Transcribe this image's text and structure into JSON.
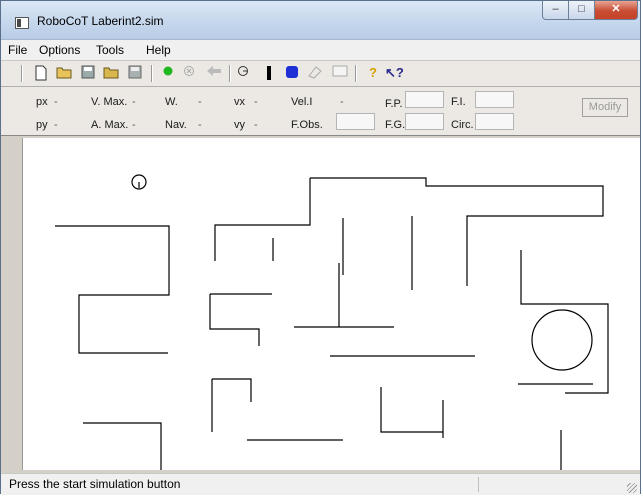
{
  "window": {
    "title": "RoboCoT Laberint2.sim"
  },
  "controls": {
    "minimize": "–",
    "maximize": "□",
    "close": "✕"
  },
  "menu": {
    "items": [
      "File",
      "Options",
      "Tools",
      "Help"
    ]
  },
  "toolbar": {
    "icons": [
      "new-icon",
      "open-icon",
      "save-icon",
      "open-folder-icon",
      "save-as-icon",
      "start-icon",
      "stop-icon",
      "back-icon",
      "robot-icon",
      "wall-tool-icon",
      "obstacle-tool-icon",
      "eraser-icon",
      "rectangle-tool-icon",
      "help-icon",
      "context-help-icon"
    ],
    "colors": {
      "start": "#1fb81f",
      "obstacle": "#1f2fd6",
      "wall": "#000000"
    }
  },
  "params": {
    "row1": [
      {
        "label": "px",
        "value": "-"
      },
      {
        "label": "V. Max.",
        "value": "-"
      },
      {
        "label": "W.",
        "value": "-"
      },
      {
        "label": "vx",
        "value": "-"
      },
      {
        "label": "Vel.I",
        "value": "-"
      },
      {
        "label": "F.P.",
        "value": ""
      },
      {
        "label": "F.I.",
        "value": ""
      }
    ],
    "row2": [
      {
        "label": "py",
        "value": "-"
      },
      {
        "label": "A. Max.",
        "value": "-"
      },
      {
        "label": "Nav.",
        "value": "-"
      },
      {
        "label": "vy",
        "value": "-"
      },
      {
        "label": "F.Obs.",
        "value": ""
      },
      {
        "label": "F.G.",
        "value": ""
      },
      {
        "label": "Circ.",
        "value": ""
      }
    ],
    "modify_label": "Modify"
  },
  "status": {
    "text": "Press the start simulation button"
  }
}
